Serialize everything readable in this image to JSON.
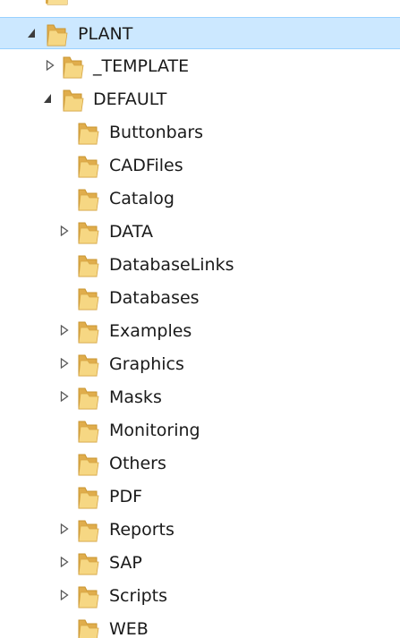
{
  "tree": {
    "root": {
      "label": "PLANT",
      "expanded": true,
      "selected": true,
      "icon": "folder-icon",
      "children": [
        {
          "label": "_TEMPLATE",
          "expandable": true,
          "expanded": false,
          "icon": "folder-icon"
        },
        {
          "label": "DEFAULT",
          "expandable": true,
          "expanded": true,
          "icon": "folder-icon",
          "children": [
            {
              "label": "Buttonbars",
              "expandable": false
            },
            {
              "label": "CADFiles",
              "expandable": false
            },
            {
              "label": "Catalog",
              "expandable": false
            },
            {
              "label": "DATA",
              "expandable": true
            },
            {
              "label": "DatabaseLinks",
              "expandable": false
            },
            {
              "label": "Databases",
              "expandable": false
            },
            {
              "label": "Examples",
              "expandable": true
            },
            {
              "label": "Graphics",
              "expandable": true
            },
            {
              "label": "Masks",
              "expandable": true
            },
            {
              "label": "Monitoring",
              "expandable": false
            },
            {
              "label": "Others",
              "expandable": false
            },
            {
              "label": "PDF",
              "expandable": false
            },
            {
              "label": "Reports",
              "expandable": true
            },
            {
              "label": "SAP",
              "expandable": true
            },
            {
              "label": "Scripts",
              "expandable": true
            },
            {
              "label": "WEB",
              "expandable": false
            }
          ]
        }
      ]
    }
  },
  "colors": {
    "selection_background": "#cce8ff",
    "selection_border": "#99d1ff",
    "folder_body": "#e8b95a",
    "folder_front": "#f6d783",
    "expander": "#595959"
  }
}
